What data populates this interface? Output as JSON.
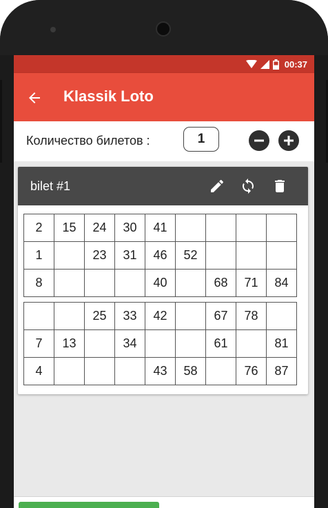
{
  "status_bar": {
    "time": "00:37",
    "icons": [
      "wifi-icon",
      "signal-icon",
      "battery-icon"
    ]
  },
  "app_bar": {
    "title": "Klassik Loto",
    "back_icon": "arrow-left-icon"
  },
  "ticket_count": {
    "label": "Количество билетов :",
    "value": "1",
    "minus_icon": "minus-circle-icon",
    "plus_icon": "plus-circle-icon"
  },
  "ticket": {
    "title": "bilet #1",
    "actions": [
      "pencil-icon",
      "refresh-icon",
      "trash-icon"
    ],
    "grid_top": [
      [
        "2",
        "15",
        "24",
        "30",
        "41",
        "",
        "",
        "",
        ""
      ],
      [
        "1",
        "",
        "23",
        "31",
        "46",
        "52",
        "",
        "",
        ""
      ],
      [
        "8",
        "",
        "",
        "",
        "40",
        "",
        "68",
        "71",
        "84"
      ]
    ],
    "grid_bottom": [
      [
        "",
        "",
        "25",
        "33",
        "42",
        "",
        "67",
        "78",
        ""
      ],
      [
        "7",
        "13",
        "",
        "34",
        "",
        "",
        "61",
        "",
        "81"
      ],
      [
        "4",
        "",
        "",
        "",
        "43",
        "58",
        "",
        "76",
        "87"
      ]
    ]
  },
  "colors": {
    "app_bar": "#e84d3c",
    "status_bar": "#c4362a",
    "ticket_header": "#484848",
    "action_button": "#4caf50"
  }
}
